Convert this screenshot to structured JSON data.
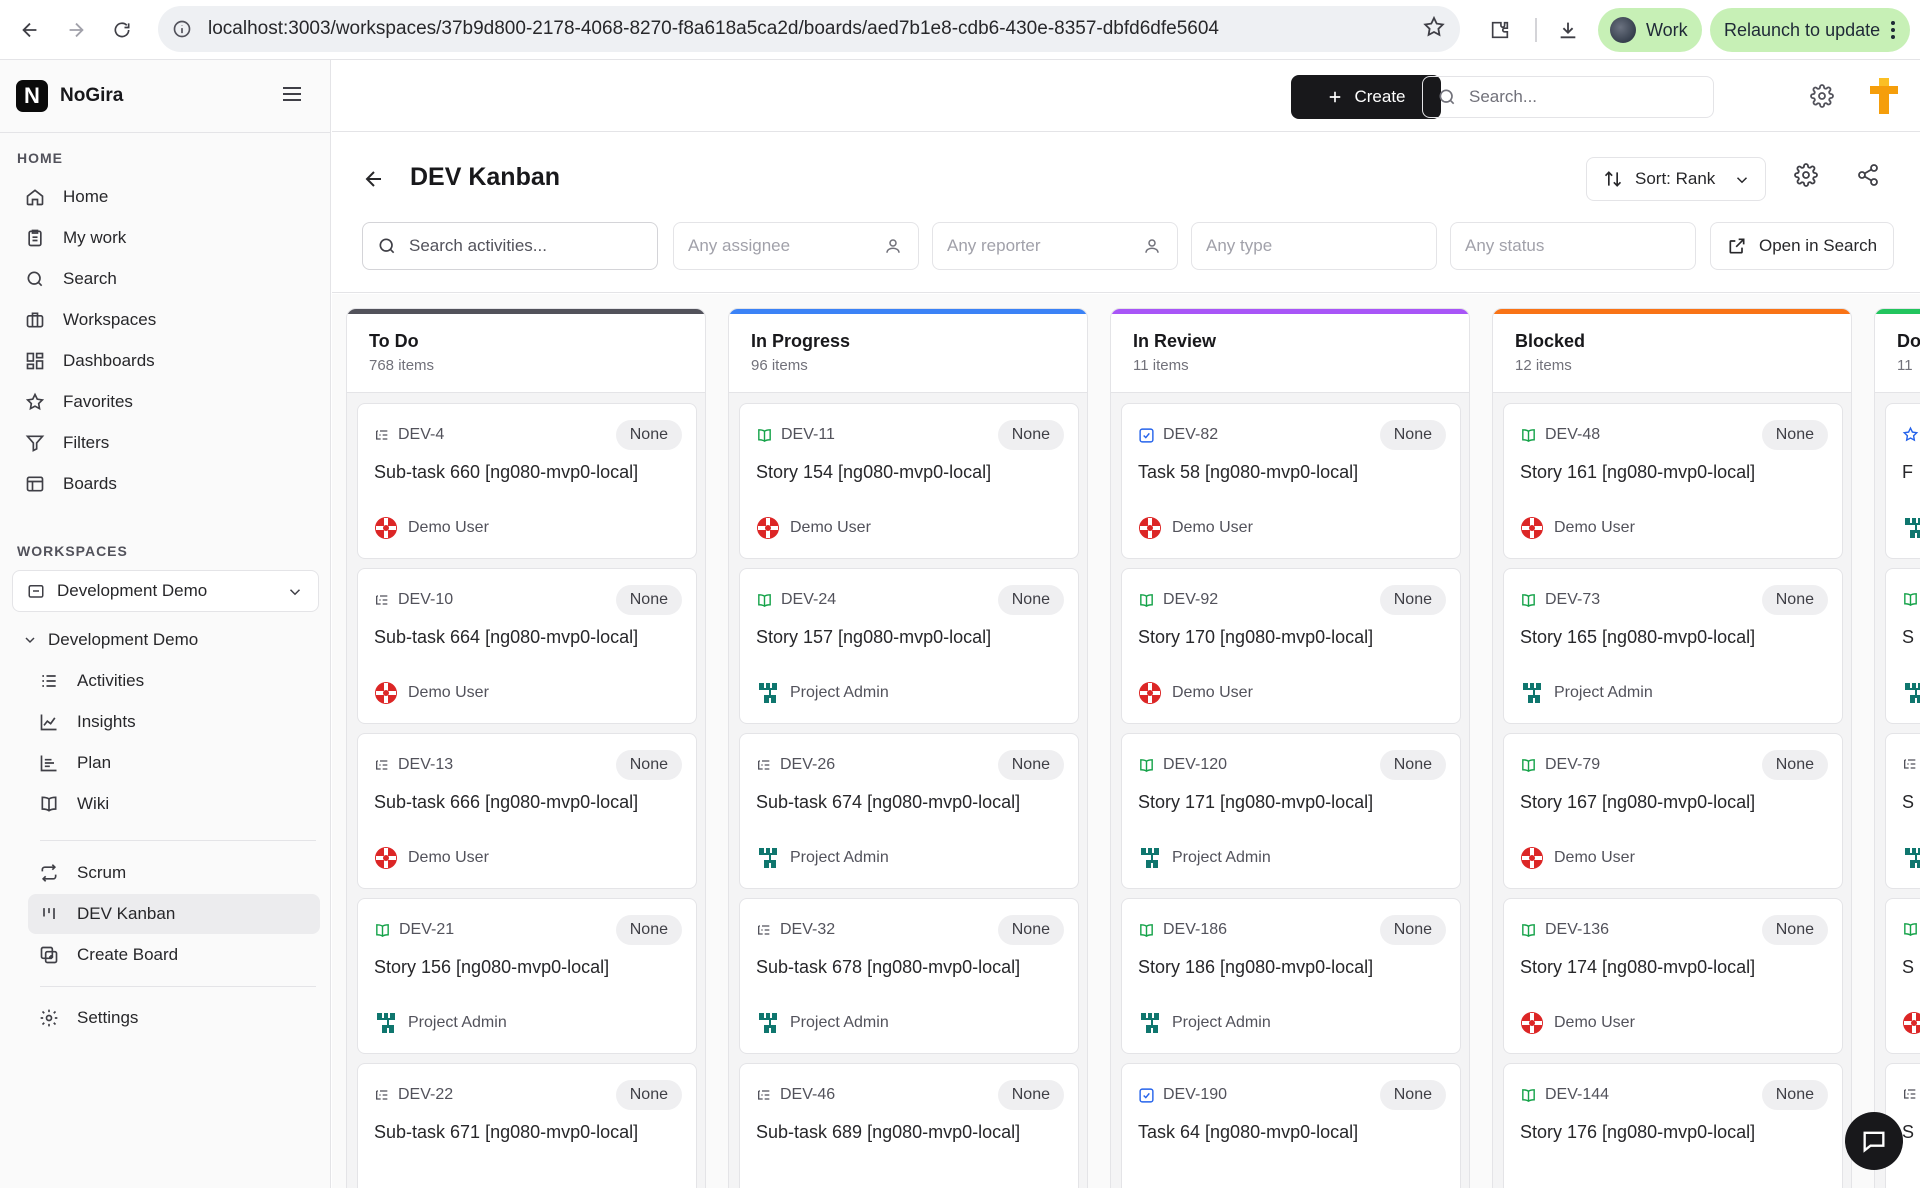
{
  "browser": {
    "url": "localhost:3003/workspaces/37b9d800-2178-4068-8270-f8a618a5ca2d/boards/aed7b1e8-cdb6-430e-8357-dbfd6dfe5604",
    "profile_label": "Work",
    "relaunch_label": "Relaunch to update"
  },
  "app": {
    "name": "NoGira",
    "logo_letter": "N"
  },
  "sidebar": {
    "home_section": "HOME",
    "home_items": [
      {
        "label": "Home",
        "icon": "home-icon"
      },
      {
        "label": "My work",
        "icon": "clipboard-icon"
      },
      {
        "label": "Search",
        "icon": "search-icon"
      },
      {
        "label": "Workspaces",
        "icon": "briefcase-icon"
      },
      {
        "label": "Dashboards",
        "icon": "dashboard-icon"
      },
      {
        "label": "Favorites",
        "icon": "star-icon"
      },
      {
        "label": "Filters",
        "icon": "filter-icon"
      },
      {
        "label": "Boards",
        "icon": "board-icon"
      }
    ],
    "workspaces_section": "WORKSPACES",
    "workspace_select": "Development Demo",
    "workspace_tree_label": "Development Demo",
    "workspace_items": [
      {
        "label": "Activities",
        "icon": "list-icon"
      },
      {
        "label": "Insights",
        "icon": "line-chart-icon"
      },
      {
        "label": "Plan",
        "icon": "plan-icon"
      },
      {
        "label": "Wiki",
        "icon": "book-icon"
      }
    ],
    "board_items": [
      {
        "label": "Scrum",
        "icon": "cycle-icon"
      },
      {
        "label": "DEV Kanban",
        "icon": "kanban-icon",
        "active": true
      },
      {
        "label": "Create Board",
        "icon": "add-board-icon"
      }
    ],
    "settings_label": "Settings"
  },
  "topbar": {
    "create_label": "Create",
    "search_placeholder": "Search..."
  },
  "board": {
    "title": "DEV Kanban",
    "sort_label": "Sort: Rank",
    "filters": {
      "search_placeholder": "Search activities...",
      "assignee_placeholder": "Any assignee",
      "reporter_placeholder": "Any reporter",
      "type_placeholder": "Any type",
      "status_placeholder": "Any status"
    },
    "open_in_search_label": "Open in Search",
    "columns": [
      {
        "title": "To Do",
        "count": "768 items",
        "color": "#52525b",
        "cards": [
          {
            "key": "DEV-4",
            "type": "subtask",
            "priority": "None",
            "title": "Sub-task 660 [ng080-mvp0-local]",
            "assignee": "Demo User",
            "avatar": "demo"
          },
          {
            "key": "DEV-10",
            "type": "subtask",
            "priority": "None",
            "title": "Sub-task 664 [ng080-mvp0-local]",
            "assignee": "Demo User",
            "avatar": "demo"
          },
          {
            "key": "DEV-13",
            "type": "subtask",
            "priority": "None",
            "title": "Sub-task 666 [ng080-mvp0-local]",
            "assignee": "Demo User",
            "avatar": "demo"
          },
          {
            "key": "DEV-21",
            "type": "story",
            "priority": "None",
            "title": "Story 156 [ng080-mvp0-local]",
            "assignee": "Project Admin",
            "avatar": "admin"
          },
          {
            "key": "DEV-22",
            "type": "subtask",
            "priority": "None",
            "title": "Sub-task 671 [ng080-mvp0-local]",
            "assignee": "",
            "avatar": ""
          }
        ]
      },
      {
        "title": "In Progress",
        "count": "96 items",
        "color": "#3b82f6",
        "cards": [
          {
            "key": "DEV-11",
            "type": "story",
            "priority": "None",
            "title": "Story 154 [ng080-mvp0-local]",
            "assignee": "Demo User",
            "avatar": "demo"
          },
          {
            "key": "DEV-24",
            "type": "story",
            "priority": "None",
            "title": "Story 157 [ng080-mvp0-local]",
            "assignee": "Project Admin",
            "avatar": "admin"
          },
          {
            "key": "DEV-26",
            "type": "subtask",
            "priority": "None",
            "title": "Sub-task 674 [ng080-mvp0-local]",
            "assignee": "Project Admin",
            "avatar": "admin"
          },
          {
            "key": "DEV-32",
            "type": "subtask",
            "priority": "None",
            "title": "Sub-task 678 [ng080-mvp0-local]",
            "assignee": "Project Admin",
            "avatar": "admin"
          },
          {
            "key": "DEV-46",
            "type": "subtask",
            "priority": "None",
            "title": "Sub-task 689 [ng080-mvp0-local]",
            "assignee": "",
            "avatar": ""
          }
        ]
      },
      {
        "title": "In Review",
        "count": "11 items",
        "color": "#a855f7",
        "cards": [
          {
            "key": "DEV-82",
            "type": "task",
            "priority": "None",
            "title": "Task 58 [ng080-mvp0-local]",
            "assignee": "Demo User",
            "avatar": "demo"
          },
          {
            "key": "DEV-92",
            "type": "story",
            "priority": "None",
            "title": "Story 170 [ng080-mvp0-local]",
            "assignee": "Demo User",
            "avatar": "demo"
          },
          {
            "key": "DEV-120",
            "type": "story",
            "priority": "None",
            "title": "Story 171 [ng080-mvp0-local]",
            "assignee": "Project Admin",
            "avatar": "admin"
          },
          {
            "key": "DEV-186",
            "type": "story",
            "priority": "None",
            "title": "Story 186 [ng080-mvp0-local]",
            "assignee": "Project Admin",
            "avatar": "admin"
          },
          {
            "key": "DEV-190",
            "type": "task",
            "priority": "None",
            "title": "Task 64 [ng080-mvp0-local]",
            "assignee": "",
            "avatar": ""
          }
        ]
      },
      {
        "title": "Blocked",
        "count": "12 items",
        "color": "#f97316",
        "cards": [
          {
            "key": "DEV-48",
            "type": "story",
            "priority": "None",
            "title": "Story 161 [ng080-mvp0-local]",
            "assignee": "Demo User",
            "avatar": "demo"
          },
          {
            "key": "DEV-73",
            "type": "story",
            "priority": "None",
            "title": "Story 165 [ng080-mvp0-local]",
            "assignee": "Project Admin",
            "avatar": "admin"
          },
          {
            "key": "DEV-79",
            "type": "story",
            "priority": "None",
            "title": "Story 167 [ng080-mvp0-local]",
            "assignee": "Demo User",
            "avatar": "demo"
          },
          {
            "key": "DEV-136",
            "type": "story",
            "priority": "None",
            "title": "Story 174 [ng080-mvp0-local]",
            "assignee": "Demo User",
            "avatar": "demo"
          },
          {
            "key": "DEV-144",
            "type": "story",
            "priority": "None",
            "title": "Story 176 [ng080-mvp0-local]",
            "assignee": "",
            "avatar": ""
          }
        ]
      },
      {
        "title": "Do",
        "count": "11",
        "color": "#22c55e",
        "cards": [
          {
            "key": "",
            "type": "star",
            "priority": "",
            "title": "F",
            "assignee": "",
            "avatar": "admin"
          },
          {
            "key": "",
            "type": "story",
            "priority": "",
            "title": "S",
            "assignee": "",
            "avatar": "admin"
          },
          {
            "key": "",
            "type": "subtask",
            "priority": "",
            "title": "S",
            "assignee": "",
            "avatar": "admin"
          },
          {
            "key": "",
            "type": "story",
            "priority": "",
            "title": "S",
            "assignee": "",
            "avatar": "demo"
          },
          {
            "key": "",
            "type": "subtask",
            "priority": "",
            "title": "S",
            "assignee": "",
            "avatar": ""
          }
        ]
      }
    ]
  }
}
